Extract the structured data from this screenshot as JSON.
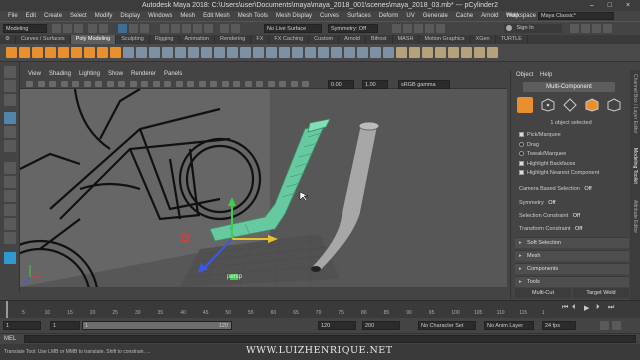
{
  "window": {
    "title": "Autodesk Maya 2018: C:\\Users\\user\\Documents\\maya\\maya_2018_001\\scenes\\maya_2018_03.mb*   ---   pCylinder2",
    "controls": "– □ ×"
  },
  "menubar": [
    "File",
    "Edit",
    "Create",
    "Select",
    "Modify",
    "Display",
    "Windows",
    "Mesh",
    "Edit Mesh",
    "Mesh Tools",
    "Mesh Display",
    "Curves",
    "Surfaces",
    "Deform",
    "UV",
    "Generate",
    "Cache",
    "Arnold",
    "Help"
  ],
  "workspace": {
    "label": "Workspace :",
    "value": "Maya Classic*"
  },
  "statusline": {
    "mode": "Modeling",
    "live_surface": "No Live Surface",
    "symmetry": "Symmetry: Off",
    "signin": "Sign In"
  },
  "shelf_tabs": [
    "Curves / Surfaces",
    "Poly Modeling",
    "Sculpting",
    "Rigging",
    "Animation",
    "Rendering",
    "FX",
    "FX Caching",
    "Custom",
    "Arnold",
    "Bifrost",
    "MASH",
    "Motion Graphics",
    "XGen",
    "TURTLE"
  ],
  "shelf_active": "Poly Modeling",
  "viewport_menu": [
    "View",
    "Shading",
    "Lighting",
    "Show",
    "Renderer",
    "Panels"
  ],
  "viewport_toolbar": {
    "value1": "0.00",
    "value2": "1.00",
    "colorspace": "sRGB gamma"
  },
  "viewport": {
    "camera_label": "persp"
  },
  "modeling_toolkit": {
    "menu": [
      "Object",
      "Help"
    ],
    "mode": "Multi-Component",
    "selected_info": "1 object selected",
    "options": [
      {
        "label": "Pick/Marquee",
        "checked": true
      },
      {
        "label": "Drag",
        "checked": false
      },
      {
        "label": "Tweak/Marquee",
        "checked": false
      },
      {
        "label": "Highlight Backfaces",
        "checked": true
      },
      {
        "label": "Highlight Nearest Component",
        "checked": true
      }
    ],
    "camera_based": {
      "label": "Camera Based Selection",
      "value": "Off"
    },
    "symmetry": {
      "label": "Symmetry",
      "value": "Off"
    },
    "selection_constraint": {
      "label": "Selection Constraint",
      "value": "Off"
    },
    "transform_constraint": {
      "label": "Transform Constraint",
      "value": "Off"
    },
    "sections": [
      "Soft Selection",
      "Mesh",
      "Components",
      "Tools"
    ],
    "multi_cut": "Multi-Cut",
    "target_weld": "Target Weld"
  },
  "side_tabs": [
    "Channel Box / Layer Editor",
    "Modeling Toolkit",
    "Attribute Editor"
  ],
  "timeline": {
    "ticks": [
      "5",
      "10",
      "15",
      "20",
      "25",
      "30",
      "35",
      "40",
      "45",
      "50",
      "55",
      "60",
      "65",
      "70",
      "75",
      "80",
      "85",
      "90",
      "95",
      "100",
      "105",
      "110",
      "115",
      "1"
    ]
  },
  "range": {
    "start": "1",
    "current": "1",
    "anim_start": "1",
    "range_end": "120",
    "end": "120",
    "anim_end": "200",
    "character_set": "No Character Set",
    "anim_layer": "No Anim Layer",
    "fps": "24 fps"
  },
  "command_line": {
    "lang": "MEL"
  },
  "help_line": "Translate Tool: Use LMB or MMB to translate. Shift to constrain. ...",
  "watermark": "WWW.LUIZHENRIQUE.NET",
  "colors": {
    "accent_orange": "#e8912c",
    "selection_green": "#6fd6b0",
    "help_blue": "#4ab2e6"
  }
}
